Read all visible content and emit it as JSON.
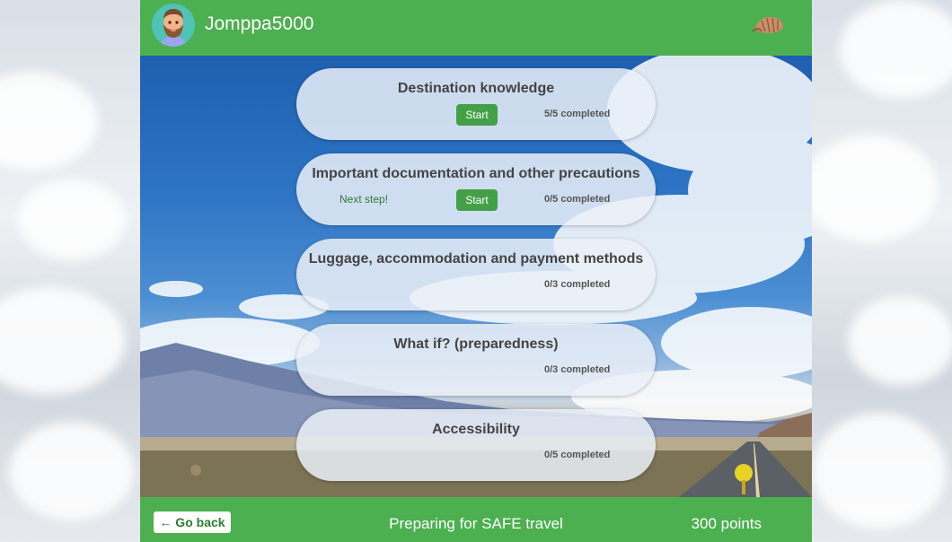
{
  "header": {
    "username": "Jomppa5000",
    "avatar_icon": "bearded-man-avatar-icon",
    "right_icon": "shell-icon"
  },
  "modules": [
    {
      "title": "Destination knowledge",
      "show_start": true,
      "start_label": "Start",
      "next_step": "",
      "progress": "5/5 completed"
    },
    {
      "title": "Important documentation and other precautions",
      "show_start": true,
      "start_label": "Start",
      "next_step": "Next step!",
      "progress": "0/5 completed"
    },
    {
      "title": "Luggage, accommodation and payment methods",
      "show_start": false,
      "start_label": "",
      "next_step": "",
      "progress": "0/3 completed"
    },
    {
      "title": "What if? (preparedness)",
      "show_start": false,
      "start_label": "",
      "next_step": "",
      "progress": "0/3 completed"
    },
    {
      "title": "Accessibility",
      "show_start": false,
      "start_label": "",
      "next_step": "",
      "progress": "0/5 completed"
    }
  ],
  "footer": {
    "back_label": "← Go back",
    "title": "Preparing for SAFE travel",
    "points": "300 points"
  },
  "colors": {
    "brand_green": "#4caf50",
    "button_green": "#43a047"
  }
}
